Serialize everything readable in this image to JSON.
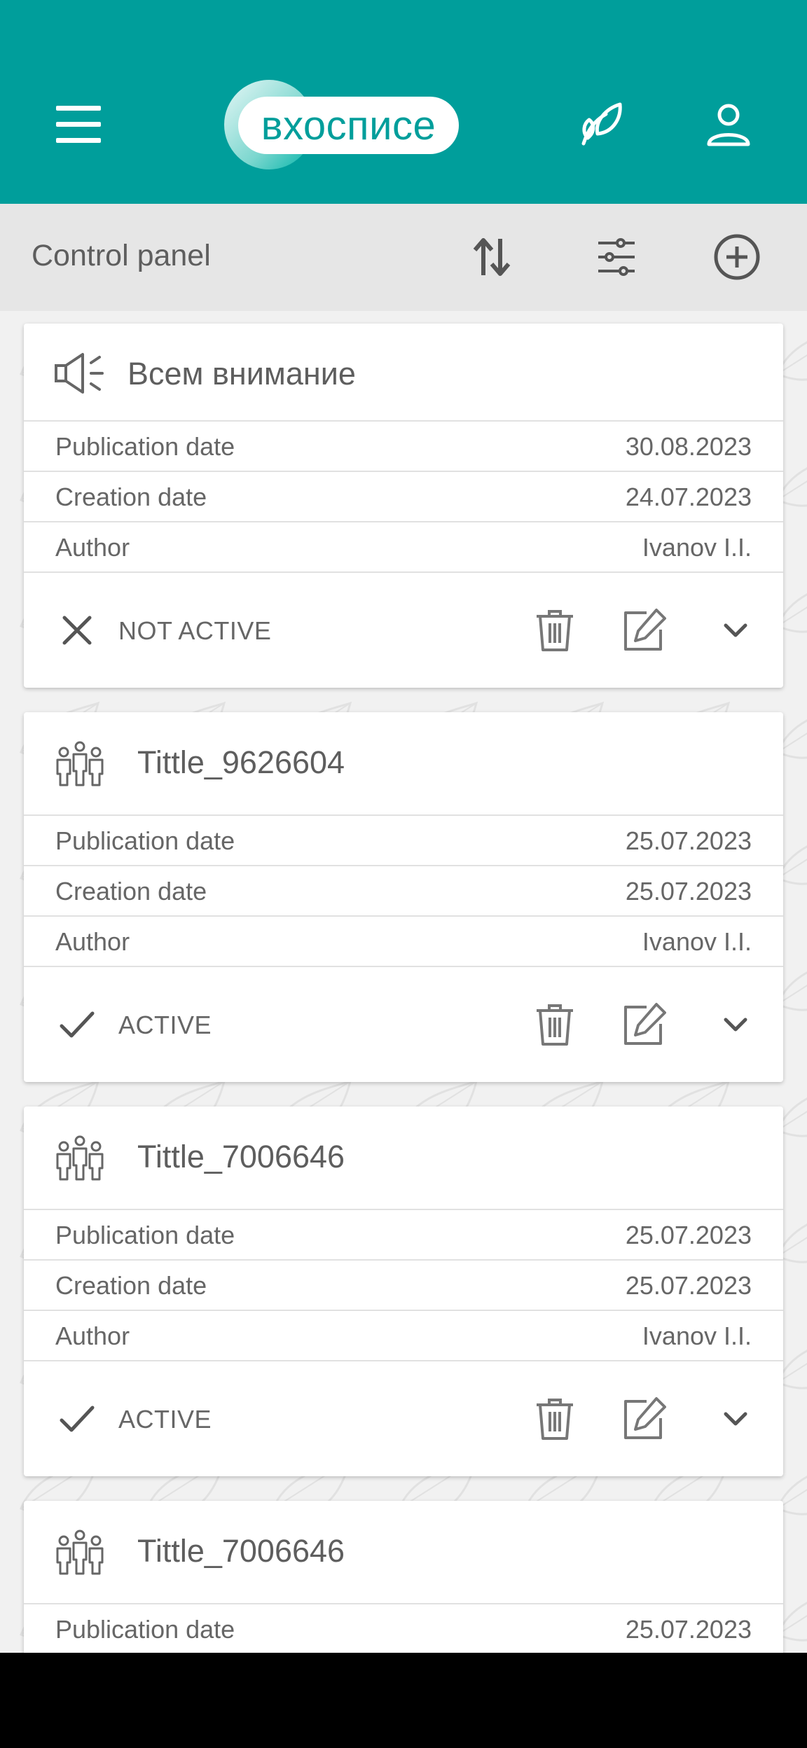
{
  "header": {
    "logo_text": "вхосписе",
    "menu_icon": "menu-icon",
    "leaf_icon": "leaf-icon",
    "profile_icon": "profile-icon",
    "color": "#009e9b"
  },
  "toolbar": {
    "title": "Control panel",
    "sort_icon": "sort-icon",
    "filter_icon": "filter-icon",
    "add_icon": "add-circle-icon"
  },
  "cards": [
    {
      "icon": "megaphone-icon",
      "title": "Всем внимание",
      "rows": [
        {
          "label": "Publication date",
          "value": "30.08.2023"
        },
        {
          "label": "Creation date",
          "value": "24.07.2023"
        },
        {
          "label": "Author",
          "value": "Ivanov I.I."
        }
      ],
      "status": "NOT ACTIVE",
      "status_icon": "close-icon"
    },
    {
      "icon": "group-icon",
      "title": "Tittle_9626604",
      "rows": [
        {
          "label": "Publication date",
          "value": "25.07.2023"
        },
        {
          "label": "Creation date",
          "value": "25.07.2023"
        },
        {
          "label": "Author",
          "value": "Ivanov I.I."
        }
      ],
      "status": "ACTIVE",
      "status_icon": "check-icon"
    },
    {
      "icon": "group-icon",
      "title": "Tittle_7006646",
      "rows": [
        {
          "label": "Publication date",
          "value": "25.07.2023"
        },
        {
          "label": "Creation date",
          "value": "25.07.2023"
        },
        {
          "label": "Author",
          "value": "Ivanov I.I."
        }
      ],
      "status": "ACTIVE",
      "status_icon": "check-icon"
    },
    {
      "icon": "group-icon",
      "title": "Tittle_7006646",
      "rows": [
        {
          "label": "Publication date",
          "value": "25.07.2023"
        }
      ]
    }
  ]
}
